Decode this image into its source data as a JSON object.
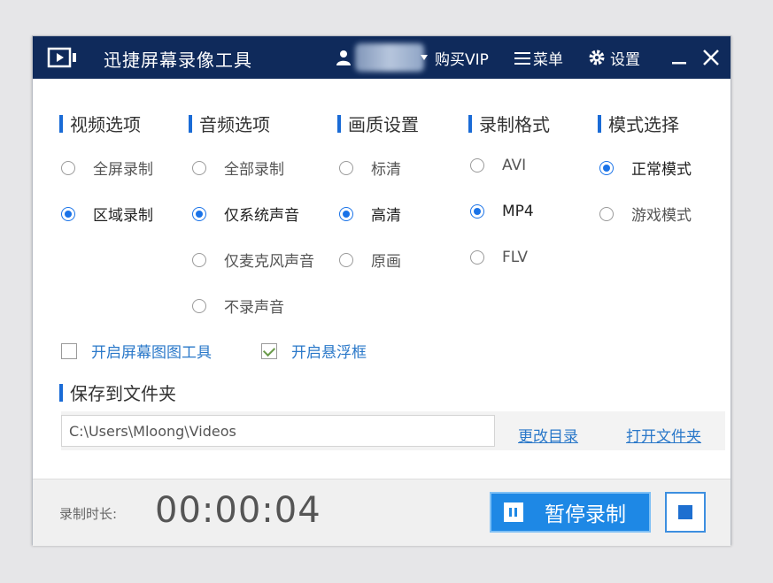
{
  "colors": {
    "titlebar": "#0f2a5b",
    "accent": "#1a73e8",
    "link": "#2a78c9",
    "pause_button": "#1e88e5"
  },
  "titlebar": {
    "app_title": "迅捷屏幕录像工具",
    "buy_vip": "购买VIP",
    "menu": "菜单",
    "settings": "设置"
  },
  "sections": {
    "video": {
      "title": "视频选项",
      "options": [
        {
          "label": "全屏录制",
          "selected": false
        },
        {
          "label": "区域录制",
          "selected": true
        }
      ]
    },
    "audio": {
      "title": "音频选项",
      "options": [
        {
          "label": "全部录制",
          "selected": false
        },
        {
          "label": "仅系统声音",
          "selected": true
        },
        {
          "label": "仅麦克风声音",
          "selected": false
        },
        {
          "label": "不录声音",
          "selected": false
        }
      ]
    },
    "quality": {
      "title": "画质设置",
      "options": [
        {
          "label": "标清",
          "selected": false
        },
        {
          "label": "高清",
          "selected": true
        },
        {
          "label": "原画",
          "selected": false
        }
      ]
    },
    "format": {
      "title": "录制格式",
      "options": [
        {
          "label": "AVI",
          "selected": false
        },
        {
          "label": "MP4",
          "selected": true
        },
        {
          "label": "FLV",
          "selected": false
        }
      ]
    },
    "mode": {
      "title": "模式选择",
      "options": [
        {
          "label": "正常模式",
          "selected": true
        },
        {
          "label": "游戏模式",
          "selected": false
        }
      ]
    }
  },
  "checkboxes": {
    "annotation_tool": {
      "label": "开启屏幕图图工具",
      "checked": false
    },
    "floating_window": {
      "label": "开启悬浮框",
      "checked": true
    }
  },
  "save": {
    "title": "保存到文件夹",
    "path": "C:\\Users\\Mloong\\Videos",
    "change_dir": "更改目录",
    "open_folder": "打开文件夹"
  },
  "footer": {
    "duration_label": "录制时长:",
    "duration": "00:00:04",
    "pause_label": "暂停录制"
  }
}
